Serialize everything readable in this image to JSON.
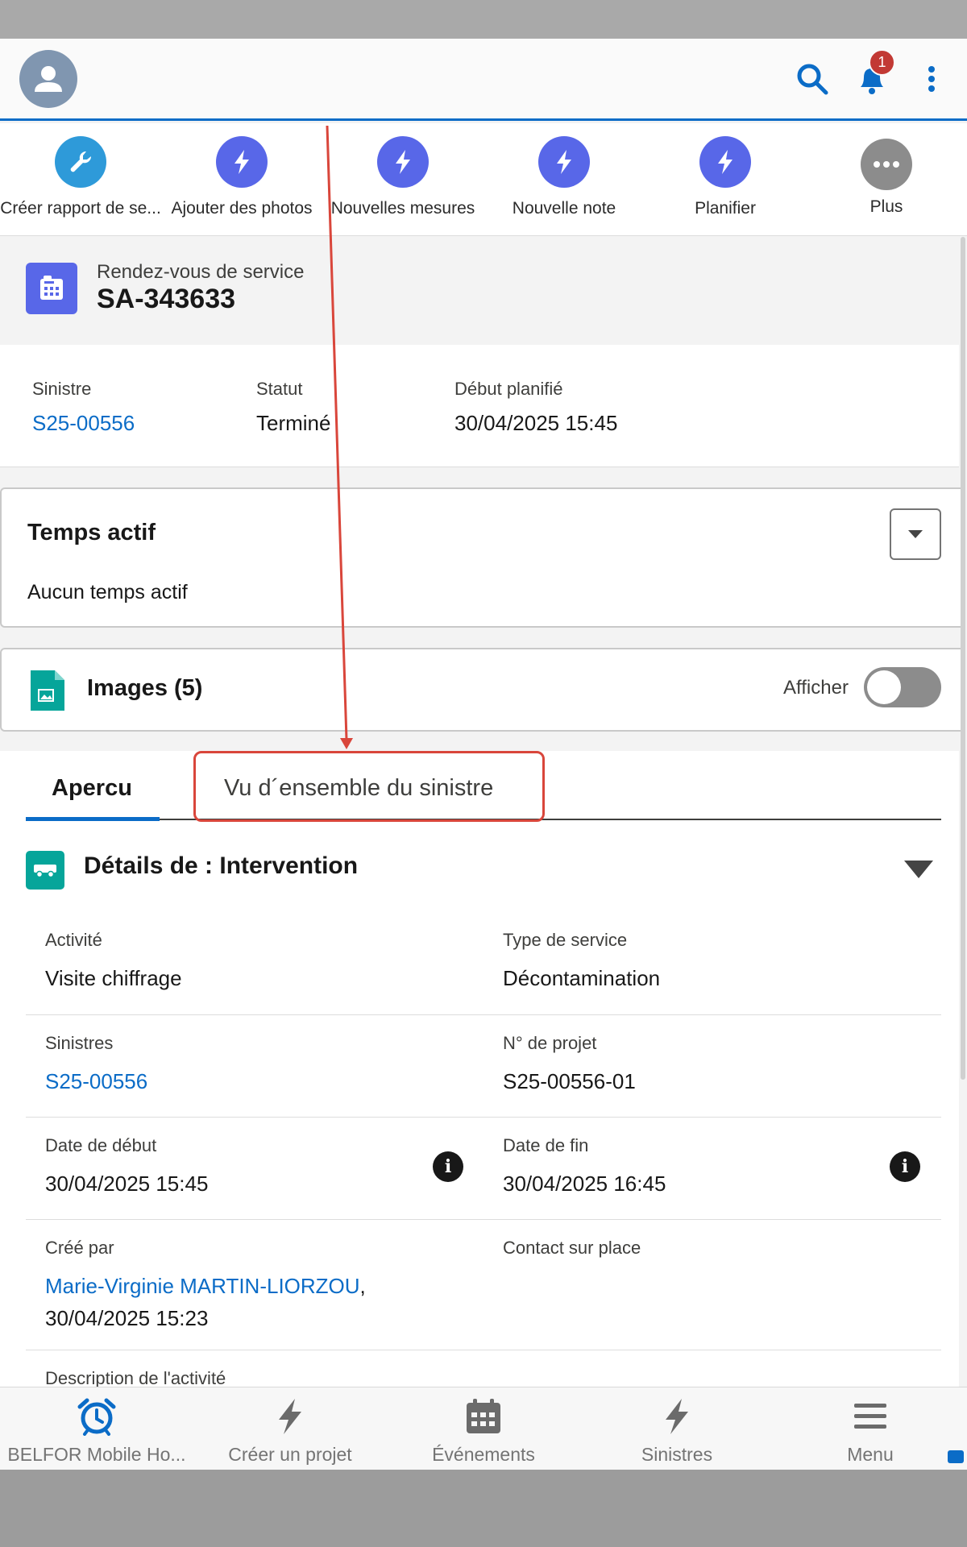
{
  "header": {
    "notification_count": "1"
  },
  "actions": [
    {
      "label": "Créer rapport de se...",
      "icon": "wrench-icon",
      "color": "#2e9ad9"
    },
    {
      "label": "Ajouter des photos",
      "icon": "lightning-icon",
      "color": "#5867e8"
    },
    {
      "label": "Nouvelles mesures",
      "icon": "lightning-icon",
      "color": "#5867e8"
    },
    {
      "label": "Nouvelle note",
      "icon": "lightning-icon",
      "color": "#5867e8"
    },
    {
      "label": "Planifier",
      "icon": "lightning-icon",
      "color": "#5867e8"
    },
    {
      "label": "Plus",
      "icon": "more-icon",
      "color": "#8c8c8c"
    }
  ],
  "record": {
    "type": "Rendez-vous de service",
    "name": "SA-343633"
  },
  "highlights": [
    {
      "label": "Sinistre",
      "value": "S25-00556",
      "link": true
    },
    {
      "label": "Statut",
      "value": "Terminé",
      "link": false
    },
    {
      "label": "Début planifié",
      "value": "30/04/2025 15:45",
      "link": false
    }
  ],
  "active_time": {
    "title": "Temps actif",
    "empty_text": "Aucun temps actif"
  },
  "images": {
    "title": "Images (5)",
    "toggle_label": "Afficher",
    "toggle_on": false
  },
  "tabs": [
    {
      "label": "Apercu",
      "active": true
    },
    {
      "label": "Vu d´ensemble du sinistre",
      "active": false
    }
  ],
  "details": {
    "title": "Détails de : Intervention",
    "rows": [
      {
        "left": {
          "label": "Activité",
          "value": "Visite chiffrage"
        },
        "right": {
          "label": "Type de service",
          "value": "Décontamination"
        }
      },
      {
        "left": {
          "label": "Sinistres",
          "value": "S25-00556"
        },
        "right": {
          "label": "N° de projet",
          "value": "S25-00556-01"
        }
      },
      {
        "left": {
          "label": "Date de début",
          "value": "30/04/2025 15:45"
        },
        "right": {
          "label": "Date de fin",
          "value": "30/04/2025 16:45"
        }
      },
      {
        "left": {
          "label": "Créé par",
          "value": "Marie-Virginie MARTIN-LIORZOU",
          "value2": "30/04/2025 15:23"
        },
        "right": {
          "label": "Contact sur place",
          "value": ""
        }
      },
      {
        "left": {
          "label": "Description de l'activité",
          "value": ""
        }
      }
    ]
  },
  "bottom_nav": [
    {
      "label": "BELFOR Mobile Ho...",
      "icon": "alarm-clock-icon",
      "active": true
    },
    {
      "label": "Créer un projet",
      "icon": "lightning-icon",
      "active": false
    },
    {
      "label": "Événements",
      "icon": "calendar-icon",
      "active": false
    },
    {
      "label": "Sinistres",
      "icon": "lightning-icon",
      "active": false
    },
    {
      "label": "Menu",
      "icon": "hamburger-icon",
      "active": false
    }
  ],
  "colors": {
    "brand_blue": "#0b6cc7",
    "annotation_red": "#d9463b"
  }
}
